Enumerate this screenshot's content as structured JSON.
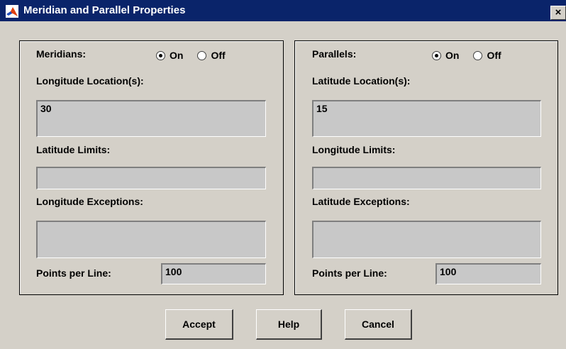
{
  "window": {
    "title": "Meridian and Parallel Properties",
    "close_label": "×"
  },
  "meridians": {
    "heading": "Meridians:",
    "on_label": "On",
    "off_label": "Off",
    "selected": "On",
    "location_label": "Longitude Location(s):",
    "location_value": "30",
    "limits_label": "Latitude Limits:",
    "limits_value": "",
    "exceptions_label": "Longitude Exceptions:",
    "exceptions_value": "",
    "points_label": "Points per Line:",
    "points_value": "100"
  },
  "parallels": {
    "heading": "Parallels:",
    "on_label": "On",
    "off_label": "Off",
    "selected": "On",
    "location_label": "Latitude Location(s):",
    "location_value": "15",
    "limits_label": "Longitude Limits:",
    "limits_value": "",
    "exceptions_label": "Latitude Exceptions:",
    "exceptions_value": "",
    "points_label": "Points per Line:",
    "points_value": "100"
  },
  "buttons": {
    "accept": "Accept",
    "help": "Help",
    "cancel": "Cancel"
  },
  "colors": {
    "titlebar": "#0a246a",
    "face": "#d4d0c8",
    "field": "#c8c8c8"
  },
  "icons": {
    "app": "matlab-logo-icon",
    "close": "close-icon"
  }
}
